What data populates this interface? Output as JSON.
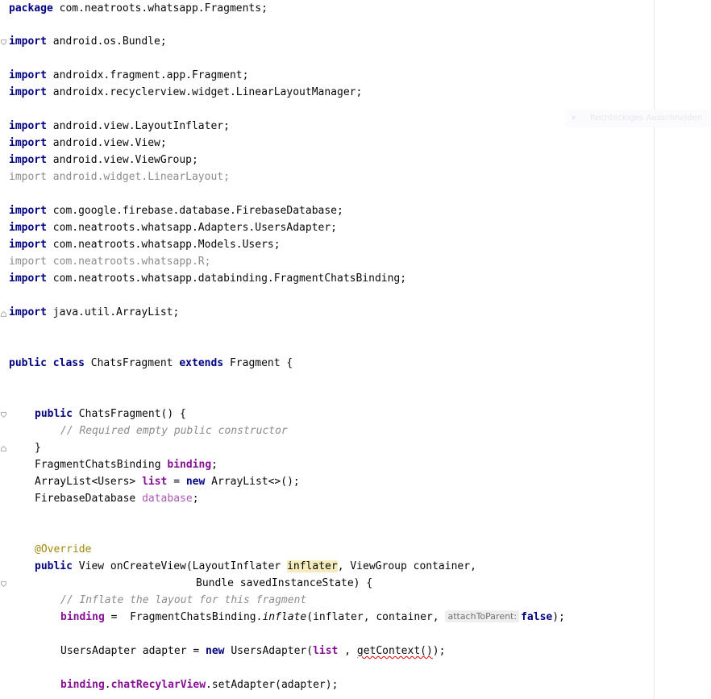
{
  "editor": {
    "language": "java",
    "file_class": "ChatsFragment"
  },
  "ghost_hint": {
    "text": "Rechteckiges Ausschneiden",
    "icon": "chevron-down-icon"
  },
  "code": {
    "l1_kw": "package",
    "l1_rest": " com.neatroots.whatsapp.Fragments;",
    "l3_kw": "import",
    "l3_rest": " android.os.Bundle;",
    "l5_kw": "import",
    "l5_rest": " androidx.fragment.app.Fragment;",
    "l6_kw": "import",
    "l6_rest": " androidx.recyclerview.widget.LinearLayoutManager;",
    "l8_kw": "import",
    "l8_rest": " android.view.LayoutInflater;",
    "l9_kw": "import",
    "l9_rest": " android.view.View;",
    "l10_kw": "import",
    "l10_rest": " android.view.ViewGroup;",
    "l11_kw": "import",
    "l11_rest": " android.widget.LinearLayout;",
    "l13_kw": "import",
    "l13_rest": " com.google.firebase.database.FirebaseDatabase;",
    "l14_kw": "import",
    "l14_rest": " com.neatroots.whatsapp.Adapters.UsersAdapter;",
    "l15_kw": "import",
    "l15_rest": " com.neatroots.whatsapp.Models.Users;",
    "l16_kw": "import",
    "l16_rest": " com.neatroots.whatsapp.R;",
    "l17_kw": "import",
    "l17_rest": " com.neatroots.whatsapp.databinding.FragmentChatsBinding;",
    "l19_kw": "import",
    "l19_rest": " java.util.ArrayList;",
    "l22_kw1": "public",
    "l22_kw2": "class",
    "l22_name": " ChatsFragment ",
    "l22_kw3": "extends",
    "l22_rest": " Fragment {",
    "l25_kw": "public",
    "l25_rest": " ChatsFragment() {",
    "l26_comment": "// Required empty public constructor",
    "l27_brace": "}",
    "l28_type": "FragmentChatsBinding ",
    "l28_field": "binding",
    "l28_semi": ";",
    "l29_type": "ArrayList<Users> ",
    "l29_field": "list",
    "l29_eq": " = ",
    "l29_kw": "new",
    "l29_rest": " ArrayList<>();",
    "l30_type": "FirebaseDatabase ",
    "l30_field": "database",
    "l30_semi": ";",
    "l33_anno": "@Override",
    "l34_kw": "public",
    "l34_pre": " View onCreateView(LayoutInflater ",
    "l34_hl": "inflater",
    "l34_post": ", ViewGroup container,",
    "l35_text": "Bundle savedInstanceState) {",
    "l36_comment": "// Inflate the layout for this fragment",
    "l37_field": "binding",
    "l37_eq": " =  FragmentChatsBinding.",
    "l37_method": "inflate",
    "l37_args": "(inflater, container, ",
    "l37_hint": "attachToParent:",
    "l37_kw": "false",
    "l37_end": ");",
    "l39_pre": "UsersAdapter adapter = ",
    "l39_kw": "new",
    "l39_mid": " UsersAdapter(",
    "l39_field": "list",
    "l39_sep": " , ",
    "l39_err": "getContext()",
    "l39_end": ");",
    "l41_field1": "binding",
    "l41_dot": ".",
    "l41_field2": "chatRecylarView",
    "l41_rest": ".setAdapter(adapter);"
  }
}
